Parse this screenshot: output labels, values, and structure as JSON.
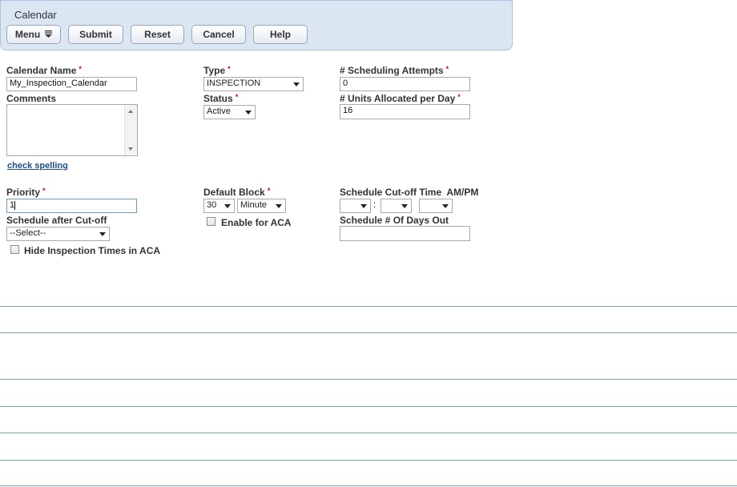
{
  "header": {
    "title": "Calendar",
    "buttons": {
      "menu": "Menu",
      "submit": "Submit",
      "reset": "Reset",
      "cancel": "Cancel",
      "help": "Help"
    }
  },
  "form": {
    "required_marker": "*",
    "calendar_name": {
      "label": "Calendar Name",
      "value": "My_Inspection_Calendar"
    },
    "comments": {
      "label": "Comments",
      "value": ""
    },
    "check_spelling": "check spelling",
    "priority": {
      "label": "Priority",
      "value": "1"
    },
    "schedule_after_cutoff": {
      "label": "Schedule after Cut-off",
      "selected": "--Select--"
    },
    "hide_inspection_times": {
      "label": "Hide Inspection Times in ACA",
      "checked": false
    },
    "type": {
      "label": "Type",
      "selected": "INSPECTION"
    },
    "status": {
      "label": "Status",
      "selected": "Active"
    },
    "default_block": {
      "label": "Default Block",
      "amount": "30",
      "unit": "Minute"
    },
    "enable_for_aca": {
      "label": "Enable for ACA",
      "checked": false
    },
    "scheduling_attempts": {
      "label": "# Scheduling Attempts",
      "value": "0"
    },
    "units_allocated": {
      "label": "# Units Allocated per Day",
      "value": "16"
    },
    "cutoff_time": {
      "label": "Schedule Cut-off Time  AM/PM",
      "separator": ":",
      "hour": "",
      "minute": "",
      "ampm": ""
    },
    "days_out": {
      "label": "Schedule # Of Days Out",
      "value": ""
    }
  },
  "colors": {
    "panel_bg": "#dbe6f3",
    "required": "#dd0000",
    "link": "#1f4e8c",
    "divider": "#7aa3b8"
  },
  "icons": {
    "menu_icon": "menu-lines-icon",
    "dropdown": "chevron-down-icon",
    "scroll_up": "scroll-up-icon",
    "scroll_down": "scroll-down-icon"
  }
}
